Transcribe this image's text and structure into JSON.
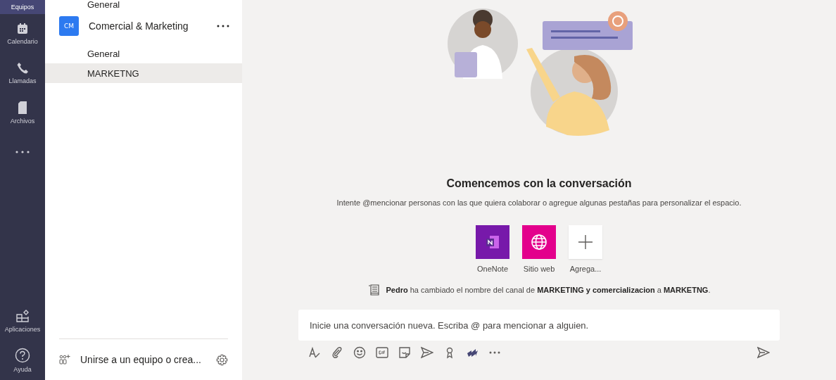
{
  "rail": {
    "top": [
      {
        "label": "Equipos",
        "selected": true
      },
      {
        "label": "Calendario",
        "selected": false
      },
      {
        "label": "Llamadas",
        "selected": false
      },
      {
        "label": "Archivos",
        "selected": false
      }
    ],
    "bottom": [
      {
        "label": "Aplicaciones",
        "selected": false
      },
      {
        "label": "Ayuda",
        "selected": false
      }
    ]
  },
  "teams_panel": {
    "previous_channels": [
      {
        "name": "General",
        "selected": false
      }
    ],
    "teams": [
      {
        "initials": "CM",
        "name": "Comercial & Marketing",
        "color": "#2d7af0",
        "channels": [
          {
            "name": "General",
            "selected": false
          },
          {
            "name": "MARKETNG",
            "selected": true
          }
        ]
      }
    ],
    "join": "Unirse a un equipo o crea..."
  },
  "main": {
    "heading": "Comencemos con la conversación",
    "subtitle": "Intente @mencionar personas con las que quiera colaborar o agregue algunas pestañas para personalizar el espacio.",
    "apps": [
      {
        "label": "OneNote",
        "kind": "onenote"
      },
      {
        "label": "Sitio web",
        "kind": "website"
      },
      {
        "label": "Agrega...",
        "kind": "add"
      }
    ],
    "event": "**Pedro** ha cambiado el nombre del canal de **MARKETING y comercializacion** a **MARKETNG**.",
    "compose": {
      "placeholder": "Inicie una conversación nueva. Escriba @ para mencionar a alguien."
    }
  }
}
